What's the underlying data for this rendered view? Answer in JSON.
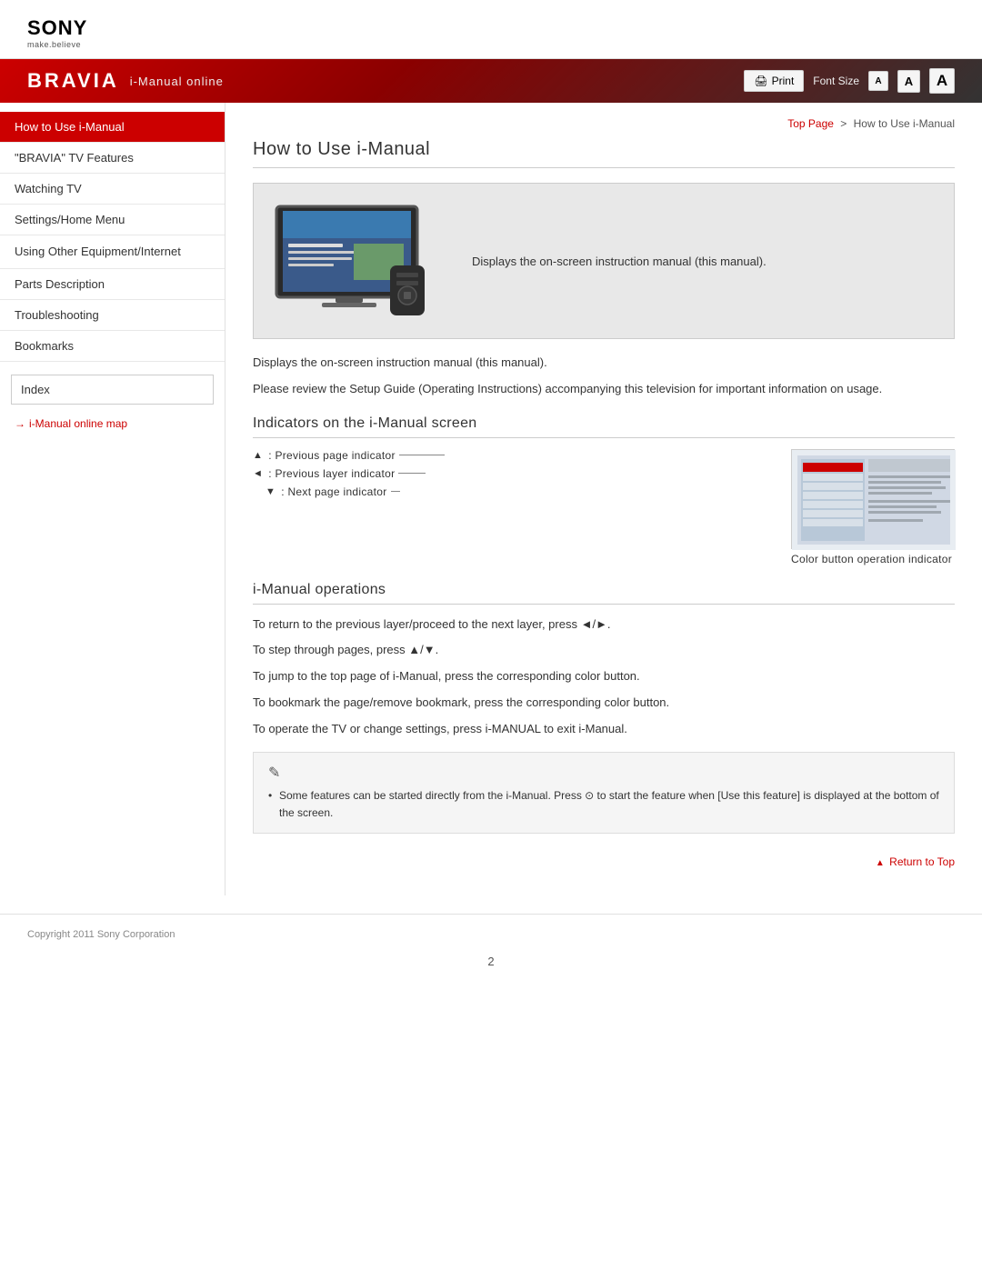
{
  "header": {
    "sony_logo": "SONY",
    "sony_tagline": "make.believe",
    "bravia_logo": "BRAVIA",
    "nav_subtitle": "i-Manual online",
    "print_label": "Print",
    "font_size_label": "Font Size",
    "font_small": "A",
    "font_medium": "A",
    "font_large": "A"
  },
  "breadcrumb": {
    "top_page": "Top Page",
    "separator": ">",
    "current": "How to Use i-Manual"
  },
  "sidebar": {
    "items": [
      {
        "label": "How to Use i-Manual",
        "active": true
      },
      {
        "label": "\"BRAVIA\" TV Features",
        "active": false
      },
      {
        "label": "Watching TV",
        "active": false
      },
      {
        "label": "Settings/Home Menu",
        "active": false
      },
      {
        "label": "Using Other Equipment/Internet",
        "active": false
      },
      {
        "label": "Parts Description",
        "active": false
      },
      {
        "label": "Troubleshooting",
        "active": false
      },
      {
        "label": "Bookmarks",
        "active": false
      }
    ],
    "index_label": "Index",
    "link_label": "i-Manual online map"
  },
  "content": {
    "page_title": "How to Use i-Manual",
    "image_caption": "Displays the on-screen instruction manual (this manual).",
    "para1": "Displays the on-screen instruction manual (this manual).",
    "para2": "Please review the Setup Guide (Operating Instructions) accompanying this television for important information on usage.",
    "section1_title": "Indicators on the i-Manual screen",
    "indicators": [
      {
        "symbol": "▲",
        "label": ": Previous page indicator"
      },
      {
        "symbol": "◄",
        "label": ": Previous layer indicator"
      },
      {
        "symbol": "▼",
        "label": ": Next page indicator"
      }
    ],
    "color_btn_label": "Color button operation indicator",
    "section2_title": "i-Manual operations",
    "op1": "To return to the previous layer/proceed to the next layer, press ◄/►.",
    "op2": "To step through pages, press ▲/▼.",
    "op3": "To jump to the top page of i-Manual, press the corresponding color button.",
    "op4": "To bookmark the page/remove bookmark, press the corresponding color button.",
    "op5": "To operate the TV or change settings, press i-MANUAL to exit i-Manual.",
    "note_bullet": "Some features can be started directly from the i-Manual. Press ⊙ to start the feature when [Use this feature] is displayed at the bottom of the screen.",
    "return_to_top": "Return to Top"
  },
  "footer": {
    "copyright": "Copyright 2011 Sony Corporation",
    "page_number": "2"
  }
}
